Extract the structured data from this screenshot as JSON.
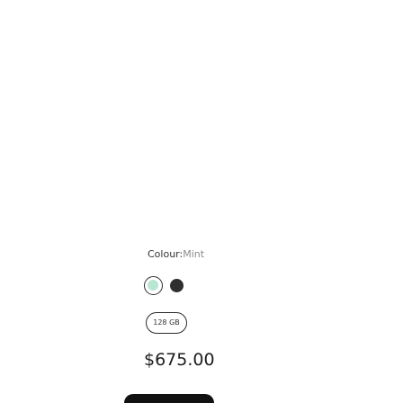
{
  "colour": {
    "label": "Colour",
    "separator": ":",
    "selected": "Mint",
    "swatches": [
      {
        "name": "Mint",
        "color": "#b9e6d3",
        "selected": true
      },
      {
        "name": "Black",
        "color": "#2f2f2f",
        "selected": false
      }
    ]
  },
  "storage": {
    "options": [
      "128 GB"
    ],
    "selected": "128 GB"
  },
  "price": "$675.00"
}
